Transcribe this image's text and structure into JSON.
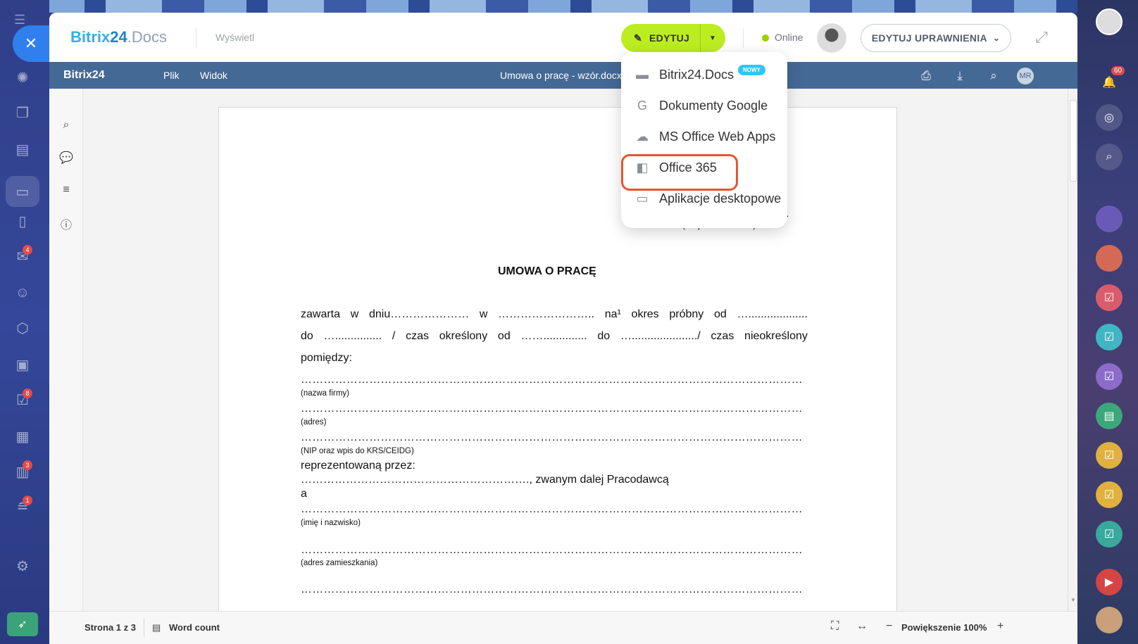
{
  "left_rail": {
    "badges": {
      "mail": "4",
      "tasks": "8",
      "crm": "3",
      "filter": "1"
    }
  },
  "header": {
    "logo_main": "Bitrix",
    "logo_num": "24",
    "logo_suffix": ".Docs",
    "view_label": "Wyświetl",
    "edit_label": "EDYTUJ",
    "online_label": "Online",
    "permissions_label": "EDYTUJ UPRAWNIENIA"
  },
  "editor": {
    "brand": "Bitrix24",
    "menu": [
      "Plik",
      "Widok"
    ],
    "doc_title": "Umowa o pracę - wzór.docx",
    "user_initials": "MR"
  },
  "dropdown": {
    "items": [
      {
        "label": "Bitrix24.Docs",
        "badge": "NOWY"
      },
      {
        "label": "Dokumenty Google"
      },
      {
        "label": "MS Office Web Apps"
      },
      {
        "label": "Office 365"
      },
      {
        "label": "Aplikacje desktopowe"
      }
    ]
  },
  "right_rail": {
    "notifications": "60"
  },
  "document": {
    "place_date_dots": "…………………………",
    "place_date_label": "(miejscowość i data)",
    "heading": "UMOWA O PRACĘ",
    "line1": [
      "zawarta",
      "w",
      "dniu…………………",
      "w",
      "……………………..",
      "na¹",
      "okres",
      "próbny",
      "od",
      "…..................."
    ],
    "line2": [
      "do",
      "…...............",
      "/",
      "czas",
      "określony",
      "od",
      "……..............",
      "do",
      "…...................../",
      "czas",
      "nieokreślony"
    ],
    "line3": "pomiędzy:",
    "dots_line": "………………………………………………………………………………………………………………………………………………………………",
    "company_label": "(nazwa firmy)",
    "address_label": "(adres)",
    "nip_label": "(NIP oraz wpis do KRS/CEIDG)",
    "represented": "reprezentowaną przez:",
    "employer_line": "……………………………………………………., zwanym dalej Pracodawcą",
    "and": "a",
    "name_label": "(imię i nazwisko)",
    "home_label": "(adres zamieszkania)"
  },
  "status": {
    "page": "Strona 1 z 3",
    "word_count": "Word count",
    "zoom": "Powiększenie 100%"
  }
}
